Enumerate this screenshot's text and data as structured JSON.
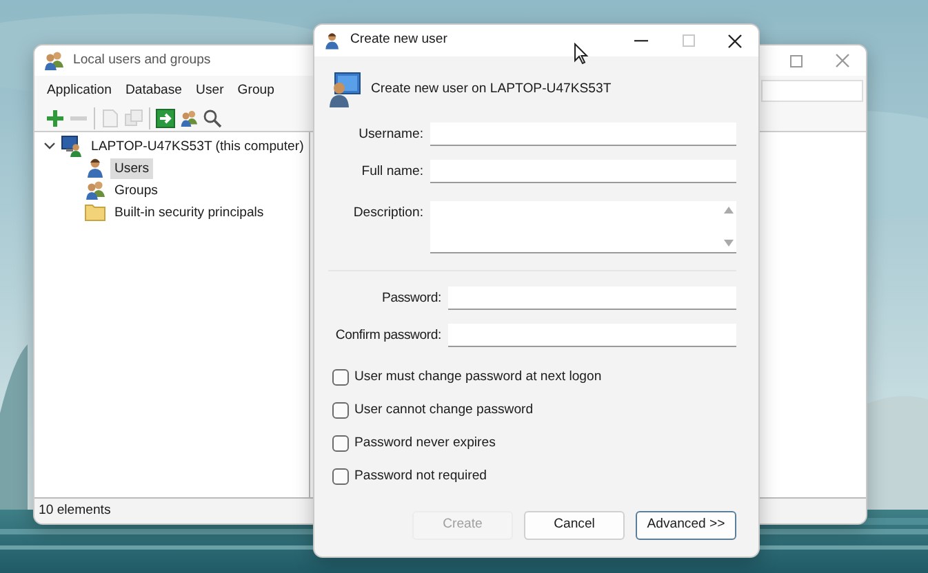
{
  "back_window": {
    "title": "Local users and groups",
    "menu": [
      "Application",
      "Database",
      "User",
      "Group"
    ],
    "toolbar": [
      {
        "kind": "add",
        "disabled": false
      },
      {
        "kind": "remove",
        "disabled": true
      },
      {
        "kind": "page",
        "disabled": true
      },
      {
        "kind": "copy",
        "disabled": true
      },
      {
        "kind": "go",
        "disabled": false
      },
      {
        "kind": "users",
        "disabled": false
      },
      {
        "kind": "search",
        "disabled": false
      }
    ],
    "tree": [
      {
        "label": "LAPTOP-U47KS53T (this computer)",
        "kind": "computer",
        "expanded": true,
        "selected": false,
        "children": [
          {
            "label": "Users",
            "kind": "user",
            "selected": true
          },
          {
            "label": "Groups",
            "kind": "group",
            "selected": false
          },
          {
            "label": "Built-in security principals",
            "kind": "folder",
            "selected": false
          }
        ]
      }
    ],
    "status": "10 elements"
  },
  "dialog": {
    "title": "Create new user",
    "heading": "Create new user on LAPTOP-U47KS53T",
    "fields": [
      {
        "label": "Username:",
        "kind": "text"
      },
      {
        "label": "Full name:",
        "kind": "text"
      },
      {
        "label": "Description:",
        "kind": "multiline"
      }
    ],
    "password_fields": [
      {
        "label": "Password:"
      },
      {
        "label": "Confirm password:"
      }
    ],
    "options": [
      {
        "label": "User must change password at next logon",
        "checked": false
      },
      {
        "label": "User cannot change password",
        "checked": false
      },
      {
        "label": "Password never expires",
        "checked": false
      },
      {
        "label": "Password not required",
        "checked": false
      }
    ],
    "buttons": [
      {
        "label": "Create",
        "disabled": true,
        "default": false
      },
      {
        "label": "Cancel",
        "disabled": false,
        "default": false
      },
      {
        "label": "Advanced >>",
        "disabled": false,
        "default": true
      }
    ]
  }
}
